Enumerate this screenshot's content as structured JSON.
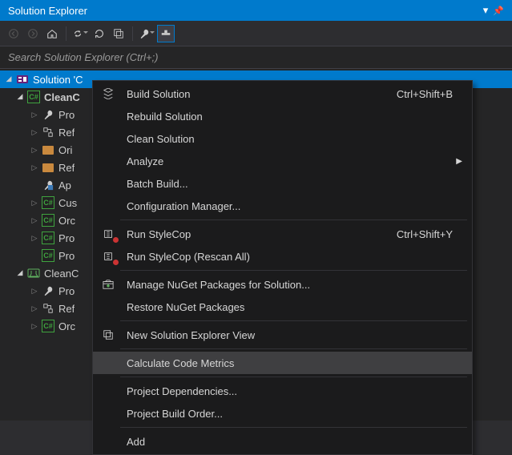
{
  "title": "Solution Explorer",
  "search_placeholder": "Search Solution Explorer (Ctrl+;)",
  "tree": {
    "solution_label": "Solution 'C",
    "project1": {
      "label": "CleanC"
    },
    "p1_props": "Pro",
    "p1_refs": "Ref",
    "p1_ori": "Ori",
    "p1_ref2": "Ref",
    "p1_app": "Ap",
    "p1_cus": "Cus",
    "p1_orc": "Orc",
    "p1_pro": "Pro",
    "p1_pro2": "Pro",
    "project2": {
      "label": "CleanC"
    },
    "p2_props": "Pro",
    "p2_refs": "Ref",
    "p2_orc": "Orc"
  },
  "menu": {
    "build": "Build Solution",
    "build_sc": "Ctrl+Shift+B",
    "rebuild": "Rebuild Solution",
    "clean": "Clean Solution",
    "analyze": "Analyze",
    "batch": "Batch Build...",
    "config": "Configuration Manager...",
    "stylecop": "Run StyleCop",
    "stylecop_sc": "Ctrl+Shift+Y",
    "stylecop_rescan": "Run StyleCop (Rescan All)",
    "nuget_manage": "Manage NuGet Packages for Solution...",
    "nuget_restore": "Restore NuGet Packages",
    "new_view": "New Solution Explorer View",
    "metrics": "Calculate Code Metrics",
    "deps": "Project Dependencies...",
    "order": "Project Build Order...",
    "add": "Add"
  }
}
